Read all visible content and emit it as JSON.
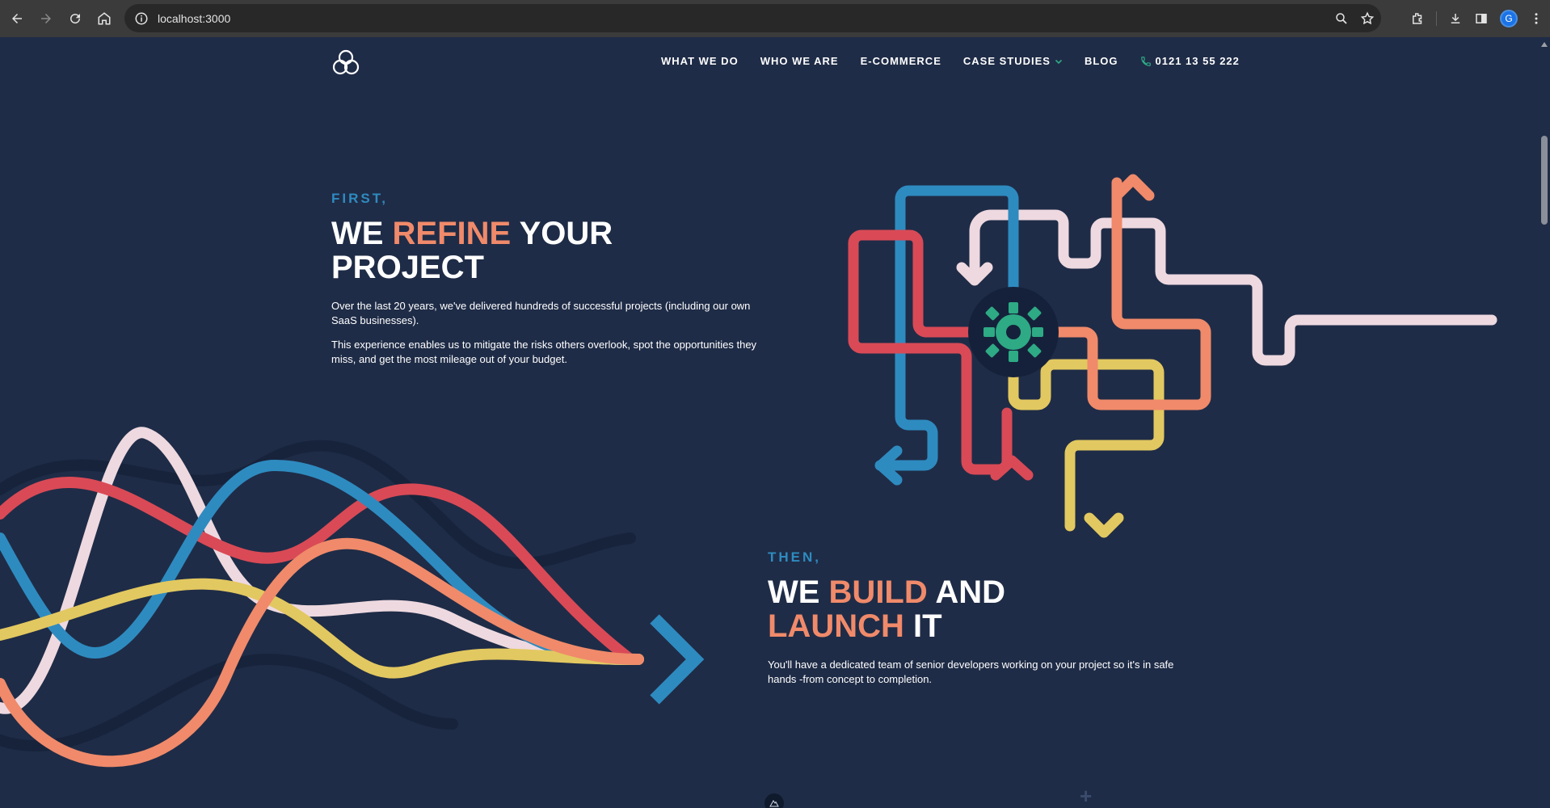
{
  "browser": {
    "url": "localhost:3000",
    "profile_initial": "G",
    "icons": [
      "back-icon",
      "forward-icon",
      "reload-icon",
      "home-icon",
      "site-info-icon",
      "zoom-icon",
      "bookmark-star-icon",
      "extensions-icon",
      "downloads-icon",
      "side-panel-icon",
      "more-menu-icon"
    ]
  },
  "nav": {
    "items": [
      {
        "label": "WHAT WE DO"
      },
      {
        "label": "WHO WE ARE"
      },
      {
        "label": "E-COMMERCE"
      },
      {
        "label": "CASE STUDIES"
      },
      {
        "label": "BLOG"
      }
    ],
    "phone": "0121 13 55 222"
  },
  "section_refine": {
    "kicker": "FIRST,",
    "headline_pre": "WE ",
    "headline_accent": "REFINE",
    "headline_post": " YOUR",
    "headline_line2": "PROJECT",
    "para1": "Over the last 20 years, we've delivered hundreds of successful projects (including our own SaaS businesses).",
    "para2": "This experience enables us to mitigate the risks others overlook, spot the opportunities they miss, and get the most mileage out of your budget."
  },
  "section_build": {
    "kicker": "THEN,",
    "headline_pre": "WE ",
    "headline_accent": "BUILD",
    "headline_post": " AND",
    "headline_line2_accent": "LAUNCH",
    "headline_line2_post": " IT",
    "para1": "You'll have a dedicated team of senior developers working on your project so it's in safe hands -from concept to completion."
  },
  "colors": {
    "background": "#1f2c47",
    "accent_orange": "#f08a6a",
    "kicker_blue": "#2e8bc0",
    "line_red": "#d94a56",
    "line_blue": "#2e8bc0",
    "line_pink": "#eed9e0",
    "line_yellow": "#e2c860",
    "line_salmon": "#f08a6a",
    "gear_green": "#2eaa85"
  }
}
